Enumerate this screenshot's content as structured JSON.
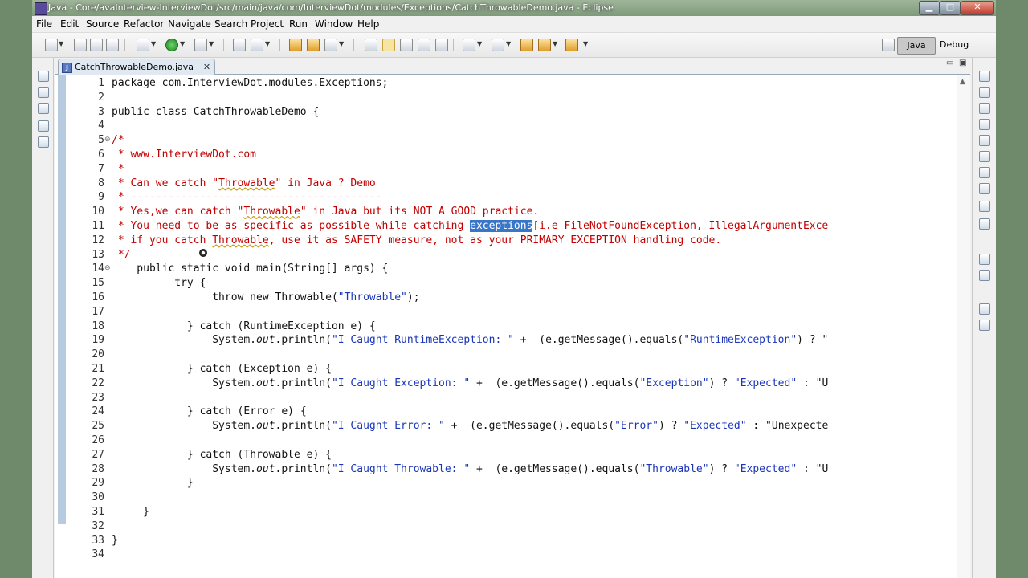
{
  "window": {
    "title": "Java - Core/avaInterview-InterviewDot/src/main/java/com/InterviewDot/modules/Exceptions/CatchThrowableDemo.java - Eclipse",
    "min_glyph": "▁",
    "max_glyph": "□",
    "close_glyph": "✕"
  },
  "menu": [
    "File",
    "Edit",
    "Source",
    "Refactor",
    "Navigate",
    "Search",
    "Project",
    "Run",
    "Window",
    "Help"
  ],
  "perspectives": {
    "java": "Java",
    "debug": "Debug"
  },
  "editor_tab": {
    "label": "CatchThrowableDemo.java",
    "icon_glyph": "J",
    "close_glyph": "✕"
  },
  "code_lines": [
    {
      "n": "1",
      "fold": "",
      "parts": [
        [
          "kw",
          "package "
        ],
        [
          "",
          "com.InterviewDot.modules.Exceptions;"
        ]
      ]
    },
    {
      "n": "2",
      "fold": "",
      "parts": []
    },
    {
      "n": "3",
      "fold": "",
      "parts": [
        [
          "kw",
          "public class "
        ],
        [
          "",
          "CatchThrowableDemo {"
        ]
      ]
    },
    {
      "n": "4",
      "fold": "",
      "parts": []
    },
    {
      "n": "5",
      "fold": "⊖",
      "parts": [
        [
          "cm",
          "/*"
        ]
      ]
    },
    {
      "n": "6",
      "fold": "",
      "parts": [
        [
          "cm",
          " * www.InterviewDot.com"
        ]
      ]
    },
    {
      "n": "7",
      "fold": "",
      "parts": [
        [
          "cm",
          " *"
        ]
      ]
    },
    {
      "n": "8",
      "fold": "",
      "parts": [
        [
          "cm",
          " * Can we catch \""
        ],
        [
          "cm sq",
          "Throwable"
        ],
        [
          "cm",
          "\" in Java ? Demo"
        ]
      ]
    },
    {
      "n": "9",
      "fold": "",
      "parts": [
        [
          "cm",
          " * ----------------------------------------"
        ]
      ]
    },
    {
      "n": "10",
      "fold": "",
      "parts": [
        [
          "cm",
          " * Yes,we can catch \""
        ],
        [
          "cm sq",
          "Throwable"
        ],
        [
          "cm",
          "\" in Java but its NOT A GOOD practice."
        ]
      ]
    },
    {
      "n": "11",
      "fold": "",
      "parts": [
        [
          "cm",
          " * You need to be as specific as possible while catching "
        ],
        [
          "hl",
          "exceptions"
        ],
        [
          "cm",
          "[i.e FileNotFoundException, IllegalArgumentExce"
        ]
      ]
    },
    {
      "n": "12",
      "fold": "",
      "parts": [
        [
          "cm",
          " * if you catch "
        ],
        [
          "cm sq",
          "Throwable"
        ],
        [
          "cm",
          ", use it as SAFETY measure, not as your PRIMARY EXCEPTION handling code."
        ]
      ]
    },
    {
      "n": "13",
      "fold": "",
      "parts": [
        [
          "cm",
          " */"
        ]
      ]
    },
    {
      "n": "14",
      "fold": "⊖",
      "parts": [
        [
          "kw",
          "    public static void "
        ],
        [
          "",
          "main(String[] args) {"
        ]
      ]
    },
    {
      "n": "15",
      "fold": "",
      "parts": [
        [
          "kw",
          "          try "
        ],
        [
          "",
          "{"
        ]
      ]
    },
    {
      "n": "16",
      "fold": "",
      "parts": [
        [
          "kw",
          "                throw new "
        ],
        [
          "",
          "Throwable("
        ],
        [
          "st",
          "\"Throwable\""
        ],
        [
          "",
          ");"
        ]
      ]
    },
    {
      "n": "17",
      "fold": "",
      "parts": []
    },
    {
      "n": "18",
      "fold": "",
      "parts": [
        [
          "",
          "            } "
        ],
        [
          "kw",
          "catch "
        ],
        [
          "",
          "(RuntimeException e) {"
        ]
      ]
    },
    {
      "n": "19",
      "fold": "",
      "parts": [
        [
          "",
          "                System."
        ],
        [
          "it",
          "out"
        ],
        [
          "",
          ".println("
        ],
        [
          "st",
          "\"I Caught RuntimeException: \""
        ],
        [
          "",
          " +  (e.getMessage().equals("
        ],
        [
          "st",
          "\"RuntimeException\""
        ],
        [
          "",
          ") ? \""
        ]
      ]
    },
    {
      "n": "20",
      "fold": "",
      "parts": []
    },
    {
      "n": "21",
      "fold": "",
      "parts": [
        [
          "",
          "            } "
        ],
        [
          "kw",
          "catch "
        ],
        [
          "",
          "(Exception e) {"
        ]
      ]
    },
    {
      "n": "22",
      "fold": "",
      "parts": [
        [
          "",
          "                System."
        ],
        [
          "it",
          "out"
        ],
        [
          "",
          ".println("
        ],
        [
          "st",
          "\"I Caught Exception: \""
        ],
        [
          "",
          " +  (e.getMessage().equals("
        ],
        [
          "st",
          "\"Exception\""
        ],
        [
          "",
          ") ? "
        ],
        [
          "st",
          "\"Expected\""
        ],
        [
          "",
          " : \"U"
        ]
      ]
    },
    {
      "n": "23",
      "fold": "",
      "parts": []
    },
    {
      "n": "24",
      "fold": "",
      "parts": [
        [
          "",
          "            } "
        ],
        [
          "kw",
          "catch "
        ],
        [
          "",
          "(Error e) {"
        ]
      ]
    },
    {
      "n": "25",
      "fold": "",
      "parts": [
        [
          "",
          "                System."
        ],
        [
          "it",
          "out"
        ],
        [
          "",
          ".println("
        ],
        [
          "st",
          "\"I Caught Error: \""
        ],
        [
          "",
          " +  (e.getMessage().equals("
        ],
        [
          "st",
          "\"Error\""
        ],
        [
          "",
          ") ? "
        ],
        [
          "st",
          "\"Expected\""
        ],
        [
          "",
          " : \"Unexpecte"
        ]
      ]
    },
    {
      "n": "26",
      "fold": "",
      "parts": []
    },
    {
      "n": "27",
      "fold": "",
      "parts": [
        [
          "",
          "            } "
        ],
        [
          "kw",
          "catch "
        ],
        [
          "",
          "(Throwable e) {"
        ]
      ]
    },
    {
      "n": "28",
      "fold": "",
      "parts": [
        [
          "",
          "                System."
        ],
        [
          "it",
          "out"
        ],
        [
          "",
          ".println("
        ],
        [
          "st",
          "\"I Caught Throwable: \""
        ],
        [
          "",
          " +  (e.getMessage().equals("
        ],
        [
          "st",
          "\"Throwable\""
        ],
        [
          "",
          ") ? "
        ],
        [
          "st",
          "\"Expected\""
        ],
        [
          "",
          " : \"U"
        ]
      ]
    },
    {
      "n": "29",
      "fold": "",
      "parts": [
        [
          "",
          "            }"
        ]
      ]
    },
    {
      "n": "30",
      "fold": "",
      "parts": []
    },
    {
      "n": "31",
      "fold": "",
      "parts": [
        [
          "",
          "     }"
        ]
      ]
    },
    {
      "n": "32",
      "fold": "",
      "parts": []
    },
    {
      "n": "33",
      "fold": "",
      "parts": [
        [
          "",
          "}"
        ]
      ]
    },
    {
      "n": "34",
      "fold": "",
      "parts": []
    }
  ]
}
